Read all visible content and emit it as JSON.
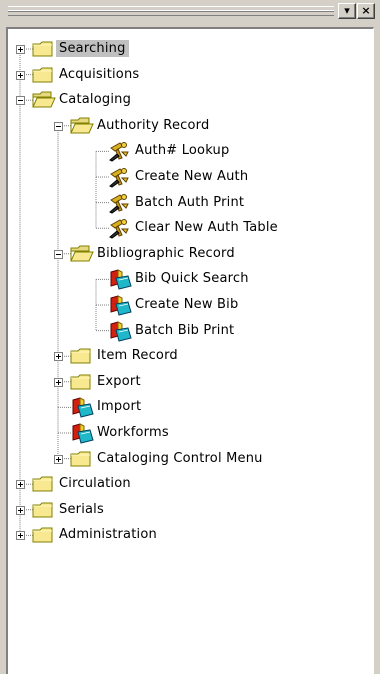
{
  "window": {
    "minimize_glyph": "▾",
    "close_glyph": "×"
  },
  "tree": {
    "selected": "Searching",
    "items": [
      {
        "label": "Searching",
        "depth": 0,
        "icon": "folder-closed-icon",
        "expander": "plus",
        "selected": true
      },
      {
        "label": "Acquisitions",
        "depth": 0,
        "icon": "folder-closed-icon",
        "expander": "plus"
      },
      {
        "label": "Cataloging",
        "depth": 0,
        "icon": "folder-open-icon",
        "expander": "minus"
      },
      {
        "label": "Authority Record",
        "depth": 1,
        "icon": "folder-open-icon",
        "expander": "minus"
      },
      {
        "label": "Auth# Lookup",
        "depth": 2,
        "icon": "authority-tool-icon"
      },
      {
        "label": "Create New Auth",
        "depth": 2,
        "icon": "authority-tool-icon"
      },
      {
        "label": "Batch Auth Print",
        "depth": 2,
        "icon": "authority-tool-icon"
      },
      {
        "label": "Clear New Auth Table",
        "depth": 2,
        "icon": "authority-tool-icon"
      },
      {
        "label": "Bibliographic Record",
        "depth": 1,
        "icon": "folder-open-icon",
        "expander": "minus"
      },
      {
        "label": "Bib Quick Search",
        "depth": 2,
        "icon": "bib-book-icon"
      },
      {
        "label": "Create New Bib",
        "depth": 2,
        "icon": "bib-book-icon"
      },
      {
        "label": "Batch Bib Print",
        "depth": 2,
        "icon": "bib-book-icon"
      },
      {
        "label": "Item Record",
        "depth": 1,
        "icon": "folder-closed-icon",
        "expander": "plus"
      },
      {
        "label": "Export",
        "depth": 1,
        "icon": "folder-closed-icon",
        "expander": "plus"
      },
      {
        "label": "Import",
        "depth": 1,
        "icon": "bib-book-icon"
      },
      {
        "label": "Workforms",
        "depth": 1,
        "icon": "bib-book-icon"
      },
      {
        "label": "Cataloging Control Menu",
        "depth": 1,
        "icon": "folder-closed-icon",
        "expander": "plus"
      },
      {
        "label": "Circulation",
        "depth": 0,
        "icon": "folder-closed-icon",
        "expander": "plus"
      },
      {
        "label": "Serials",
        "depth": 0,
        "icon": "folder-closed-icon",
        "expander": "plus"
      },
      {
        "label": "Administration",
        "depth": 0,
        "icon": "folder-closed-icon",
        "expander": "plus"
      }
    ]
  },
  "colors": {
    "folder_fill": "#f8e890",
    "folder_stroke": "#808000",
    "selection": "#c0c0c0",
    "connector": "#808080"
  }
}
